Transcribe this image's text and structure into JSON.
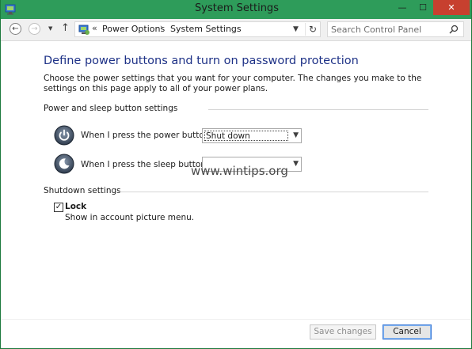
{
  "window": {
    "title": "System Settings",
    "close_symbol": "✕",
    "minimize_symbol": "—",
    "maximize_symbol": "☐"
  },
  "navbar": {
    "back_icon": "back-arrow-icon",
    "forward_icon": "forward-arrow-icon",
    "up_icon": "up-arrow-icon",
    "address": {
      "overflow_chevron": "«",
      "breadcrumbs": [
        "Power Options",
        "System Settings"
      ],
      "separator": "›"
    },
    "search": {
      "placeholder": "Search Control Panel"
    }
  },
  "main": {
    "title": "Define power buttons and turn on password protection",
    "description": "Choose the power settings that you want for your computer. The changes you make to the settings on this page apply to all of your power plans.",
    "power_section": {
      "heading": "Power and sleep button settings",
      "power_button": {
        "label": "When I press the power button:",
        "value": "Shut down"
      },
      "sleep_button": {
        "label": "When I press the sleep button:",
        "value": ""
      }
    },
    "shutdown_section": {
      "heading": "Shutdown settings",
      "lock": {
        "label": "Lock",
        "checked": true,
        "description": "Show in account picture menu."
      }
    },
    "watermark": "www.wintips.org"
  },
  "footer": {
    "save_label": "Save changes",
    "cancel_label": "Cancel"
  },
  "colors": {
    "titlebar": "#2e9c5a",
    "close_button": "#c7402f",
    "heading_blue": "#1e3287",
    "focus_border": "#3d7ad6"
  }
}
